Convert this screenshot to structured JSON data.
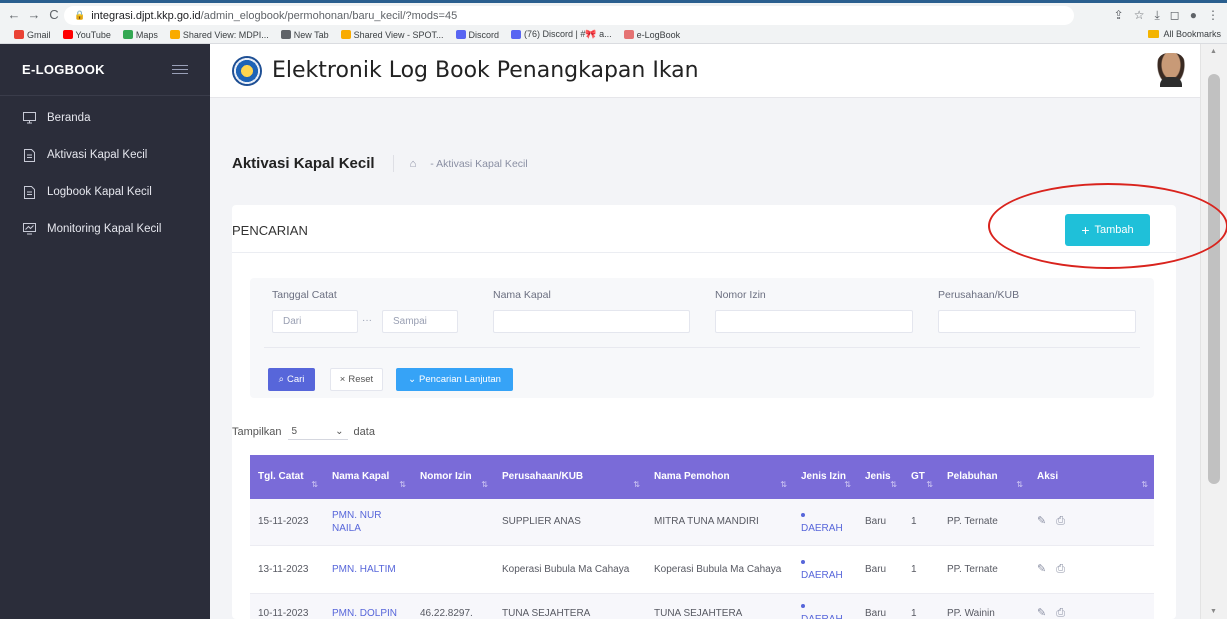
{
  "browser": {
    "url_host": "integrasi.djpt.kkp.go.id",
    "url_path": "/admin_elogbook/permohonan/baru_kecil/?mods=45",
    "bookmarks": [
      {
        "label": "Gmail",
        "color": "#ea4335"
      },
      {
        "label": "YouTube",
        "color": "#ff0000"
      },
      {
        "label": "Maps",
        "color": "#34a853"
      },
      {
        "label": "Shared View: MDPI...",
        "color": "#f9ab00"
      },
      {
        "label": "New Tab",
        "color": "#5f6368"
      },
      {
        "label": "Shared View - SPOT...",
        "color": "#f9ab00"
      },
      {
        "label": "Discord",
        "color": "#5865f2"
      },
      {
        "label": "(76) Discord | #🎀 a...",
        "color": "#5865f2"
      },
      {
        "label": "e-LogBook",
        "color": "#e57373"
      }
    ],
    "all_bookmarks": "All Bookmarks"
  },
  "sidebar": {
    "brand": "E-LOGBOOK",
    "items": [
      {
        "label": "Beranda",
        "icon": "monitor-icon"
      },
      {
        "label": "Aktivasi Kapal Kecil",
        "icon": "document-icon"
      },
      {
        "label": "Logbook Kapal Kecil",
        "icon": "document-icon"
      },
      {
        "label": "Monitoring Kapal Kecil",
        "icon": "chart-screen-icon"
      }
    ]
  },
  "header": {
    "title": "Elektronik Log Book Penangkapan Ikan"
  },
  "breadcrumb": {
    "page_title": "Aktivasi Kapal Kecil",
    "current": "- Aktivasi Kapal Kecil"
  },
  "card": {
    "title": "PENCARIAN",
    "add_button": "Tambah"
  },
  "filters": {
    "tanggal_label": "Tanggal Catat",
    "dari_placeholder": "Dari",
    "sep": "···",
    "sampai_placeholder": "Sampai",
    "nama_kapal_label": "Nama Kapal",
    "nomor_izin_label": "Nomor Izin",
    "perusahaan_label": "Perusahaan/KUB",
    "cari": "Cari",
    "reset": "Reset",
    "lanjutan": "Pencarian Lanjutan"
  },
  "show": {
    "prefix": "Tampilkan",
    "value": "5",
    "suffix": "data"
  },
  "table": {
    "headers": [
      "Tgl. Catat",
      "Nama Kapal",
      "Nomor Izin",
      "Perusahaan/KUB",
      "Nama Pemohon",
      "Jenis Izin",
      "Jenis",
      "GT",
      "Pelabuhan",
      "Aksi"
    ],
    "rows": [
      {
        "tgl": "15-11-2023",
        "kapal": "PMN. NUR NAILA",
        "izin": "",
        "perusahaan": "SUPPLIER ANAS",
        "pemohon": "MITRA TUNA MANDIRI",
        "jenis_izin": "DAERAH",
        "jenis": "Baru",
        "gt": "1",
        "pelabuhan": "PP. Ternate"
      },
      {
        "tgl": "13-11-2023",
        "kapal": "PMN. HALTIM",
        "izin": "",
        "perusahaan": "Koperasi Bubula Ma Cahaya",
        "pemohon": "Koperasi Bubula Ma Cahaya",
        "jenis_izin": "DAERAH",
        "jenis": "Baru",
        "gt": "1",
        "pelabuhan": "PP. Ternate"
      },
      {
        "tgl": "10-11-2023",
        "kapal": "PMN. DOLPIN",
        "izin": "46.22.8297.",
        "perusahaan": "TUNA SEJAHTERA",
        "pemohon": "TUNA SEJAHTERA",
        "jenis_izin": "DAERAH",
        "jenis": "Baru",
        "gt": "1",
        "pelabuhan": "PP. Wainin"
      }
    ]
  },
  "colors": {
    "table_header": "#7a6bd8",
    "tambah": "#1fc0d9",
    "cari": "#5766da",
    "lanjutan": "#36a3f7",
    "annotation": "#d9231d"
  }
}
